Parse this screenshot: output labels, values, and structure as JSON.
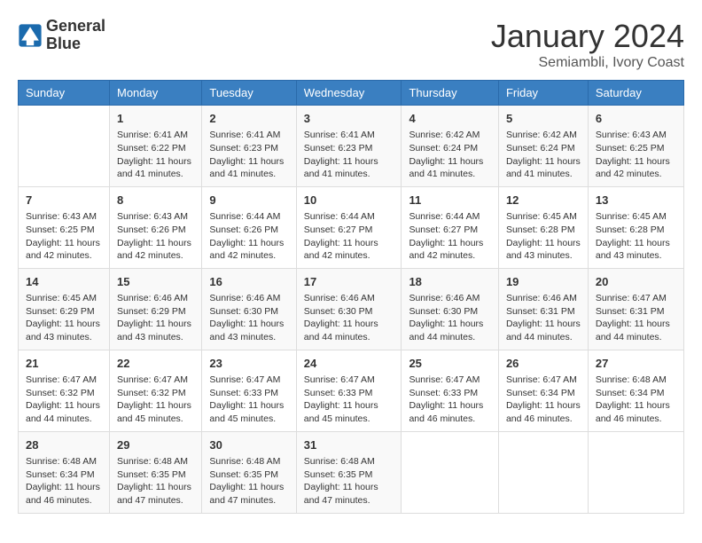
{
  "header": {
    "logo_line1": "General",
    "logo_line2": "Blue",
    "month": "January 2024",
    "location": "Semiambli, Ivory Coast"
  },
  "days_of_week": [
    "Sunday",
    "Monday",
    "Tuesday",
    "Wednesday",
    "Thursday",
    "Friday",
    "Saturday"
  ],
  "weeks": [
    [
      {
        "day": "",
        "content": ""
      },
      {
        "day": "1",
        "content": "Sunrise: 6:41 AM\nSunset: 6:22 PM\nDaylight: 11 hours and 41 minutes."
      },
      {
        "day": "2",
        "content": "Sunrise: 6:41 AM\nSunset: 6:23 PM\nDaylight: 11 hours and 41 minutes."
      },
      {
        "day": "3",
        "content": "Sunrise: 6:41 AM\nSunset: 6:23 PM\nDaylight: 11 hours and 41 minutes."
      },
      {
        "day": "4",
        "content": "Sunrise: 6:42 AM\nSunset: 6:24 PM\nDaylight: 11 hours and 41 minutes."
      },
      {
        "day": "5",
        "content": "Sunrise: 6:42 AM\nSunset: 6:24 PM\nDaylight: 11 hours and 41 minutes."
      },
      {
        "day": "6",
        "content": "Sunrise: 6:43 AM\nSunset: 6:25 PM\nDaylight: 11 hours and 42 minutes."
      }
    ],
    [
      {
        "day": "7",
        "content": "Sunrise: 6:43 AM\nSunset: 6:25 PM\nDaylight: 11 hours and 42 minutes."
      },
      {
        "day": "8",
        "content": "Sunrise: 6:43 AM\nSunset: 6:26 PM\nDaylight: 11 hours and 42 minutes."
      },
      {
        "day": "9",
        "content": "Sunrise: 6:44 AM\nSunset: 6:26 PM\nDaylight: 11 hours and 42 minutes."
      },
      {
        "day": "10",
        "content": "Sunrise: 6:44 AM\nSunset: 6:27 PM\nDaylight: 11 hours and 42 minutes."
      },
      {
        "day": "11",
        "content": "Sunrise: 6:44 AM\nSunset: 6:27 PM\nDaylight: 11 hours and 42 minutes."
      },
      {
        "day": "12",
        "content": "Sunrise: 6:45 AM\nSunset: 6:28 PM\nDaylight: 11 hours and 43 minutes."
      },
      {
        "day": "13",
        "content": "Sunrise: 6:45 AM\nSunset: 6:28 PM\nDaylight: 11 hours and 43 minutes."
      }
    ],
    [
      {
        "day": "14",
        "content": "Sunrise: 6:45 AM\nSunset: 6:29 PM\nDaylight: 11 hours and 43 minutes."
      },
      {
        "day": "15",
        "content": "Sunrise: 6:46 AM\nSunset: 6:29 PM\nDaylight: 11 hours and 43 minutes."
      },
      {
        "day": "16",
        "content": "Sunrise: 6:46 AM\nSunset: 6:30 PM\nDaylight: 11 hours and 43 minutes."
      },
      {
        "day": "17",
        "content": "Sunrise: 6:46 AM\nSunset: 6:30 PM\nDaylight: 11 hours and 44 minutes."
      },
      {
        "day": "18",
        "content": "Sunrise: 6:46 AM\nSunset: 6:30 PM\nDaylight: 11 hours and 44 minutes."
      },
      {
        "day": "19",
        "content": "Sunrise: 6:46 AM\nSunset: 6:31 PM\nDaylight: 11 hours and 44 minutes."
      },
      {
        "day": "20",
        "content": "Sunrise: 6:47 AM\nSunset: 6:31 PM\nDaylight: 11 hours and 44 minutes."
      }
    ],
    [
      {
        "day": "21",
        "content": "Sunrise: 6:47 AM\nSunset: 6:32 PM\nDaylight: 11 hours and 44 minutes."
      },
      {
        "day": "22",
        "content": "Sunrise: 6:47 AM\nSunset: 6:32 PM\nDaylight: 11 hours and 45 minutes."
      },
      {
        "day": "23",
        "content": "Sunrise: 6:47 AM\nSunset: 6:33 PM\nDaylight: 11 hours and 45 minutes."
      },
      {
        "day": "24",
        "content": "Sunrise: 6:47 AM\nSunset: 6:33 PM\nDaylight: 11 hours and 45 minutes."
      },
      {
        "day": "25",
        "content": "Sunrise: 6:47 AM\nSunset: 6:33 PM\nDaylight: 11 hours and 46 minutes."
      },
      {
        "day": "26",
        "content": "Sunrise: 6:47 AM\nSunset: 6:34 PM\nDaylight: 11 hours and 46 minutes."
      },
      {
        "day": "27",
        "content": "Sunrise: 6:48 AM\nSunset: 6:34 PM\nDaylight: 11 hours and 46 minutes."
      }
    ],
    [
      {
        "day": "28",
        "content": "Sunrise: 6:48 AM\nSunset: 6:34 PM\nDaylight: 11 hours and 46 minutes."
      },
      {
        "day": "29",
        "content": "Sunrise: 6:48 AM\nSunset: 6:35 PM\nDaylight: 11 hours and 47 minutes."
      },
      {
        "day": "30",
        "content": "Sunrise: 6:48 AM\nSunset: 6:35 PM\nDaylight: 11 hours and 47 minutes."
      },
      {
        "day": "31",
        "content": "Sunrise: 6:48 AM\nSunset: 6:35 PM\nDaylight: 11 hours and 47 minutes."
      },
      {
        "day": "",
        "content": ""
      },
      {
        "day": "",
        "content": ""
      },
      {
        "day": "",
        "content": ""
      }
    ]
  ]
}
